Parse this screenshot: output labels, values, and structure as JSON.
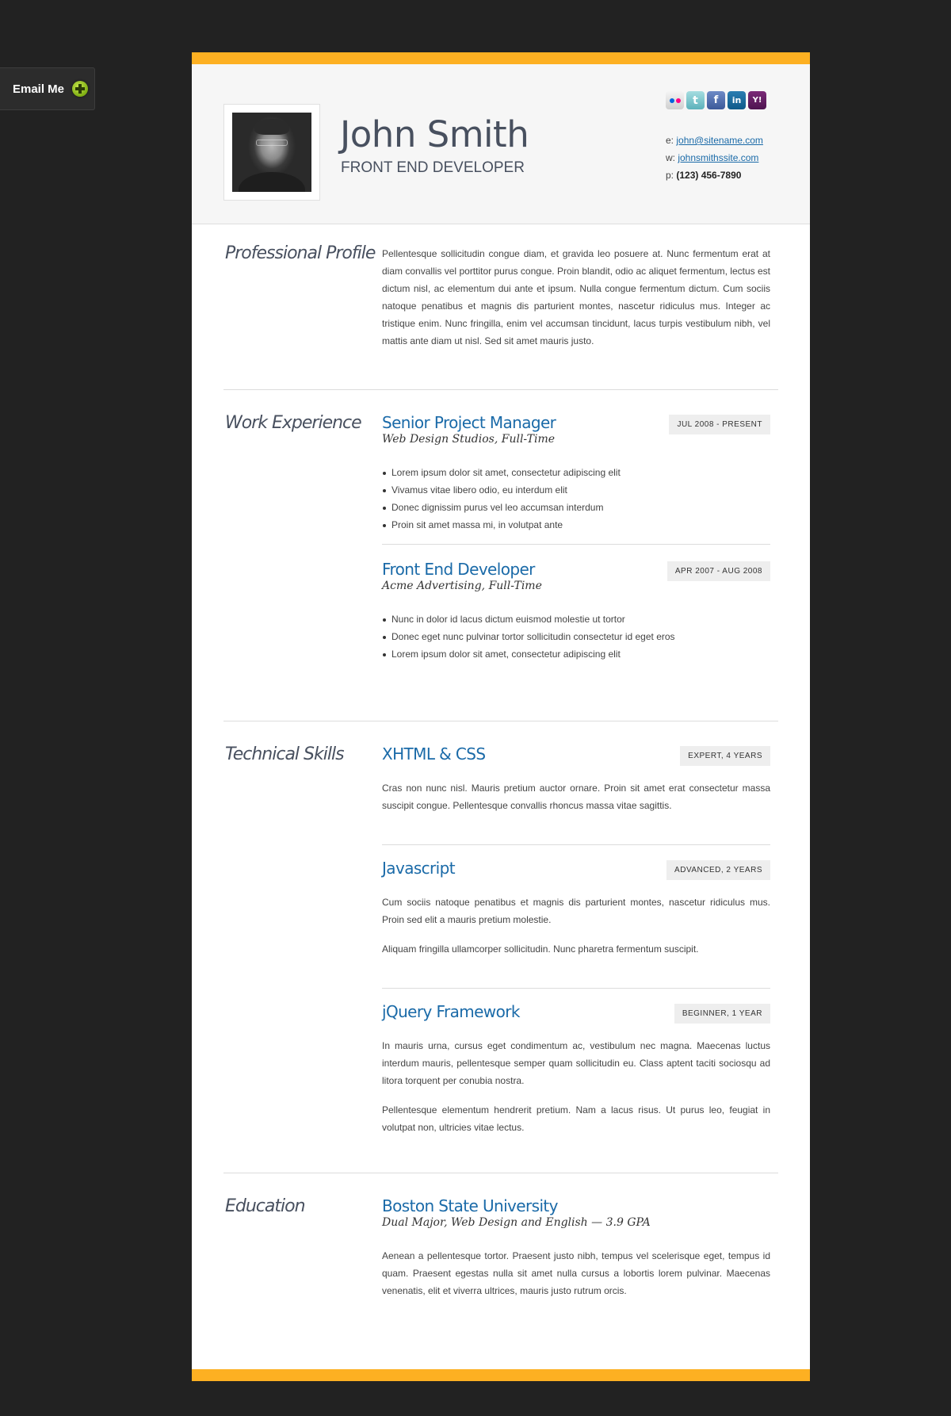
{
  "email_tab": {
    "label": "Email Me",
    "icon": "plus-circle-icon"
  },
  "header": {
    "name": "John Smith",
    "role": "FRONT END DEVELOPER",
    "social": [
      {
        "name": "flickr",
        "glyph": ""
      },
      {
        "name": "twitter",
        "glyph": "t"
      },
      {
        "name": "facebook",
        "glyph": "f"
      },
      {
        "name": "linkedin",
        "glyph": "in"
      },
      {
        "name": "yahoo",
        "glyph": "Y!"
      }
    ],
    "contacts": {
      "email_prefix": "e:",
      "email": "john@sitename.com",
      "web_prefix": "w:",
      "web": "johnsmithssite.com",
      "phone_prefix": "p:",
      "phone": "(123) 456-7890"
    }
  },
  "colors": {
    "accent": "#fdb022",
    "link": "#1a6aa8",
    "heading": "#48505f",
    "background": "#222222"
  },
  "profile": {
    "title": "Professional Profile",
    "text": "Pellentesque sollicitudin congue diam, et gravida leo posuere at. Nunc fermentum erat at diam convallis vel porttitor purus congue. Proin blandit, odio ac aliquet fermentum, lectus est dictum nisl, ac elementum dui ante et ipsum. Nulla congue fermentum dictum. Cum sociis natoque penatibus et magnis dis parturient montes, nascetur ridiculus mus. Integer ac tristique enim. Nunc fringilla, enim vel accumsan tincidunt, lacus turpis vestibulum nibh, vel mattis ante diam ut nisl. Sed sit amet mauris justo."
  },
  "work": {
    "title": "Work Experience",
    "jobs": [
      {
        "title": "Senior Project Manager",
        "company": "Web Design Studios, Full-Time",
        "dates": "JUL 2008 - PRESENT",
        "bullets": [
          "Lorem ipsum dolor sit amet, consectetur adipiscing elit",
          "Vivamus vitae libero odio, eu interdum elit",
          "Donec dignissim purus vel leo accumsan interdum",
          "Proin sit amet massa mi, in volutpat ante"
        ]
      },
      {
        "title": "Front End Developer",
        "company": "Acme Advertising, Full-Time",
        "dates": "APR 2007 - AUG 2008",
        "bullets": [
          "Nunc in dolor id lacus dictum euismod molestie ut tortor",
          "Donec eget nunc pulvinar tortor sollicitudin consectetur id eget eros",
          "Lorem ipsum dolor sit amet, consectetur adipiscing elit"
        ]
      }
    ]
  },
  "skills": {
    "title": "Technical Skills",
    "items": [
      {
        "title": "XHTML & CSS",
        "level": "EXPERT, 4 YEARS",
        "paragraphs": [
          "Cras non nunc nisl. Mauris pretium auctor ornare. Proin sit amet erat consectetur massa suscipit congue. Pellentesque convallis rhoncus massa vitae sagittis."
        ]
      },
      {
        "title": "Javascript",
        "level": "ADVANCED, 2 YEARS",
        "paragraphs": [
          "Cum sociis natoque penatibus et magnis dis parturient montes, nascetur ridiculus mus. Proin sed elit a mauris pretium molestie.",
          "Aliquam fringilla ullamcorper sollicitudin. Nunc pharetra fermentum suscipit."
        ]
      },
      {
        "title": "jQuery Framework",
        "level": "BEGINNER, 1 YEAR",
        "paragraphs": [
          "In mauris urna, cursus eget condimentum ac, vestibulum nec magna. Maecenas luctus interdum mauris, pellentesque semper quam sollicitudin eu. Class aptent taciti sociosqu ad litora torquent per conubia nostra.",
          "Pellentesque elementum hendrerit pretium. Nam a lacus risus. Ut purus leo, feugiat in volutpat non, ultricies vitae lectus."
        ]
      }
    ]
  },
  "education": {
    "title": "Education",
    "school": "Boston State University",
    "degree": "Dual Major, Web Design and English — 3.9 GPA",
    "text": "Aenean a pellentesque tortor. Praesent justo nibh, tempus vel scelerisque eget, tempus id quam. Praesent egestas nulla sit amet nulla cursus a lobortis lorem pulvinar. Maecenas venenatis, elit et viverra ultrices, mauris justo rutrum orcis."
  }
}
